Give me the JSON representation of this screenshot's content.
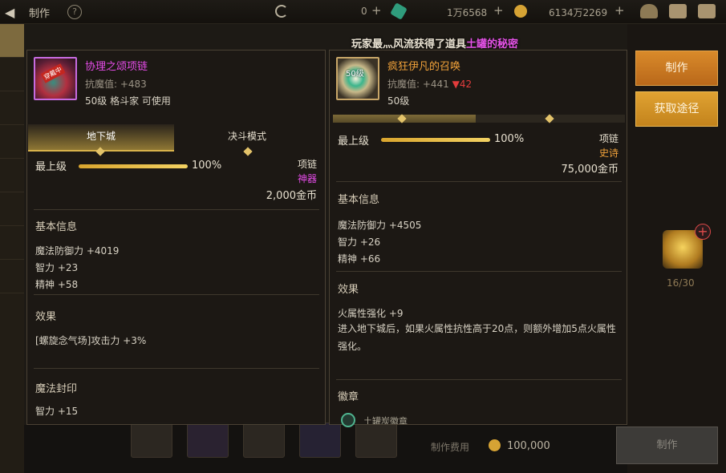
{
  "topbar": {
    "title": "制作",
    "res1": {
      "value": "0",
      "plus": "+"
    },
    "res2": {
      "value": "1万6568",
      "plus": "+"
    },
    "res3": {
      "value": "6134万2269",
      "plus": "+"
    }
  },
  "notice": {
    "prefix": "玩家最灬风流获得了道具",
    "item": "土罐的秘密"
  },
  "right_panel_buttons": {
    "craft": "制作",
    "source": "获取途径"
  },
  "material": {
    "count": "16/30"
  },
  "bottom": {
    "cost_label": "制作费用",
    "cost_value": "100,000",
    "craft_button": "制作"
  },
  "left_item": {
    "badge": "穿戴中",
    "name": "协理之颂项链",
    "resist": "抗魔值: +483",
    "level_line": "50级 格斗家 可使用",
    "tabs": [
      "地下城",
      "决斗模式"
    ],
    "level_label": "最上级",
    "level_pct": "100%",
    "level_value": 1.0,
    "slot": "项链",
    "rarity": "神器",
    "rarity_color": "#e54ce8",
    "price": "2,000金币",
    "basic_title": "基本信息",
    "stats": [
      "魔法防御力 +4019",
      "智力 +23",
      "精神 +58"
    ],
    "effect_title": "效果",
    "effect": "[螺旋念气场]攻击力 +3%",
    "seal_title": "魔法封印",
    "seal_stat": "智力 +15"
  },
  "right_item": {
    "lvl_tag": "50级",
    "name": "疯狂伊凡的召唤",
    "resist_prefix": "抗魔值: +441 ",
    "resist_diff": "▼42",
    "level_line": "50级",
    "level_label": "最上级",
    "level_pct": "100%",
    "level_value": 1.0,
    "slot": "项链",
    "rarity": "史诗",
    "rarity_color": "#f1a23a",
    "price": "75,000金币",
    "basic_title": "基本信息",
    "stats": [
      "魔法防御力 +4505",
      "智力 +26",
      "精神 +66"
    ],
    "effect_title": "效果",
    "effect_line1": "火属性强化 +9",
    "effect_line2": "进入地下城后，如果火属性抗性高于20点，则额外增加5点火属性强化。",
    "emblem_title": "徽章",
    "emblem_name": "土罐炭徽章"
  }
}
